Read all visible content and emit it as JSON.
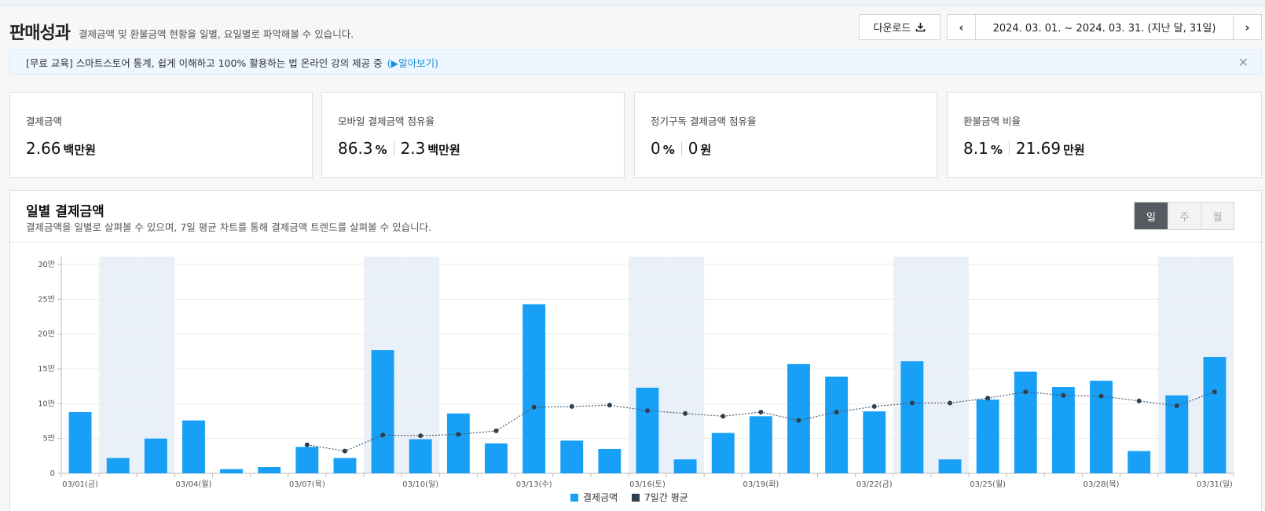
{
  "header": {
    "title": "판매성과",
    "subtitle": "결제금액 및 환불금액 현황을 일별, 요일별로 파악해볼 수 있습니다.",
    "download_label": "다운로드",
    "date_range": "2024. 03. 01. ~ 2024. 03. 31. (지난 달, 31일)"
  },
  "notice": {
    "text": "[무료 교육] 스마트스토어 통계, 쉽게 이해하고 100% 활용하는 법 온라인 강의 제공 중",
    "link": "(▶알아보기)"
  },
  "kpis": [
    {
      "label": "결제금액",
      "value1": "2.66",
      "unit1": "백만원"
    },
    {
      "label": "모바일 결제금액 점유율",
      "value1": "86.3",
      "unit1": "%",
      "value2": "2.3",
      "unit2": "백만원"
    },
    {
      "label": "정기구독 결제금액 점유율",
      "value1": "0",
      "unit1": "%",
      "value2": "0",
      "unit2": "원"
    },
    {
      "label": "환불금액 비율",
      "value1": "8.1",
      "unit1": "%",
      "value2": "21.69",
      "unit2": "만원"
    }
  ],
  "panel": {
    "title": "일별 결제금액",
    "desc": "결제금액을 일별로 살펴볼 수 있으며, 7일 평균 차트를 통해 결제금액 트렌드를 살펴볼 수 있습니다.",
    "segments": [
      "일",
      "주",
      "월"
    ]
  },
  "colors": {
    "bar": "#17a0f5",
    "avg": "#2e3f4f",
    "weekend": "#eaf0f7"
  },
  "chart_data": {
    "type": "bar",
    "categories": [
      "03/01",
      "03/02",
      "03/03",
      "03/04",
      "03/05",
      "03/06",
      "03/07",
      "03/08",
      "03/09",
      "03/10",
      "03/11",
      "03/12",
      "03/13",
      "03/14",
      "03/15",
      "03/16",
      "03/17",
      "03/18",
      "03/19",
      "03/20",
      "03/21",
      "03/22",
      "03/23",
      "03/24",
      "03/25",
      "03/26",
      "03/27",
      "03/28",
      "03/29",
      "03/30",
      "03/31"
    ],
    "series": [
      {
        "name": "결제금액",
        "values": [
          88000,
          22000,
          50000,
          76000,
          6000,
          9000,
          38000,
          22000,
          177000,
          49000,
          86000,
          43000,
          243000,
          47000,
          35000,
          123000,
          20000,
          58000,
          82000,
          157000,
          139000,
          89000,
          161000,
          20000,
          106000,
          146000,
          124000,
          133000,
          32000,
          112000,
          167000
        ]
      },
      {
        "name": "7일간 평균",
        "type": "line",
        "start_index": 6,
        "values": [
          41000,
          32000,
          55000,
          54000,
          56000,
          61000,
          95000,
          96000,
          98000,
          90000,
          86000,
          82000,
          88000,
          76000,
          88000,
          96000,
          101000,
          101000,
          108000,
          117000,
          112000,
          111000,
          104000,
          97000,
          117000
        ]
      }
    ],
    "weekend_indices": [
      1,
      2,
      8,
      9,
      15,
      16,
      22,
      23,
      29,
      30
    ],
    "x_tick_labels": [
      {
        "index": 0,
        "label": "03/01(금)"
      },
      {
        "index": 3,
        "label": "03/04(월)"
      },
      {
        "index": 6,
        "label": "03/07(목)"
      },
      {
        "index": 9,
        "label": "03/10(일)"
      },
      {
        "index": 12,
        "label": "03/13(수)"
      },
      {
        "index": 15,
        "label": "03/16(토)"
      },
      {
        "index": 18,
        "label": "03/19(화)"
      },
      {
        "index": 21,
        "label": "03/22(금)"
      },
      {
        "index": 24,
        "label": "03/25(월)"
      },
      {
        "index": 27,
        "label": "03/28(목)"
      },
      {
        "index": 30,
        "label": "03/31(일)"
      }
    ],
    "y_ticks": [
      {
        "value": 0,
        "label": "0"
      },
      {
        "value": 50000,
        "label": "5만"
      },
      {
        "value": 100000,
        "label": "10만"
      },
      {
        "value": 150000,
        "label": "15만"
      },
      {
        "value": 200000,
        "label": "20만"
      },
      {
        "value": 250000,
        "label": "25만"
      },
      {
        "value": 300000,
        "label": "30만"
      }
    ],
    "ylim": [
      0,
      300000
    ],
    "grid": true,
    "legend_position": "bottom-center"
  }
}
